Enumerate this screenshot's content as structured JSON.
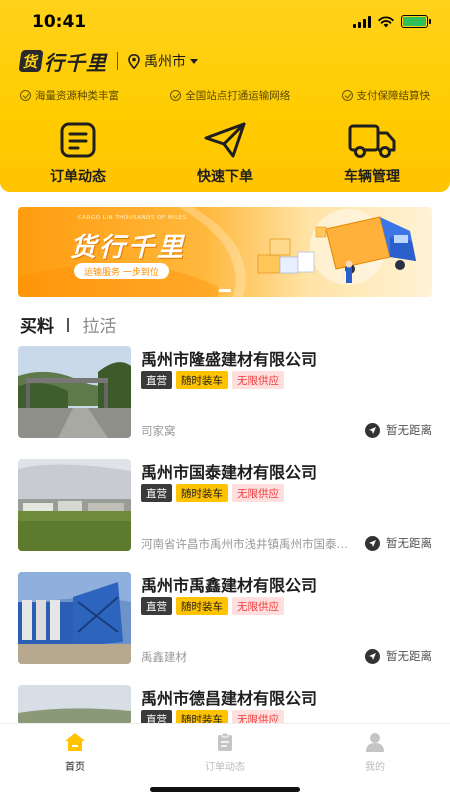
{
  "status_bar": {
    "time": "10:41"
  },
  "header": {
    "logo_badge": "货",
    "logo_text": "行千里",
    "city": "禹州市",
    "features": [
      "海量资源种类丰富",
      "全国站点打通运输网络",
      "支付保障结算快"
    ]
  },
  "quick_actions": [
    {
      "label": "订单动态",
      "icon": "order-doc-icon"
    },
    {
      "label": "快速下单",
      "icon": "paper-plane-icon"
    },
    {
      "label": "车辆管理",
      "icon": "truck-icon"
    }
  ],
  "banner": {
    "small_text": "CARGO LIN THOUSANDS OF MILES",
    "title": "货行千里",
    "slogan": "运输服务 一步到位"
  },
  "section_tabs": [
    {
      "label": "买料",
      "active": true
    },
    {
      "label": "拉活",
      "active": false
    }
  ],
  "tag_labels": {
    "direct": "直营",
    "loading": "随时装车",
    "supply": "无限供应"
  },
  "suppliers": [
    {
      "name": "禹州市隆盛建材有限公司",
      "address": "司家窝",
      "distance": "暂无距离"
    },
    {
      "name": "禹州市国泰建材有限公司",
      "address": "河南省许昌市禹州市浅井镇禹州市国泰建材有限公司",
      "distance": "暂无距离"
    },
    {
      "name": "禹州市禹鑫建材有限公司",
      "address": "禹鑫建材",
      "distance": "暂无距离"
    },
    {
      "name": "禹州市德昌建材有限公司",
      "address": "",
      "distance": ""
    }
  ],
  "tabbar": [
    {
      "label": "首页",
      "icon": "home-icon",
      "active": true
    },
    {
      "label": "订单动态",
      "icon": "clipboard-icon",
      "active": false
    },
    {
      "label": "我的",
      "icon": "user-icon",
      "active": false
    }
  ],
  "colors": {
    "brand_yellow": "#ffcc00",
    "tag_dark": "#3a3a3a",
    "tag_red": "#f03c3c"
  }
}
